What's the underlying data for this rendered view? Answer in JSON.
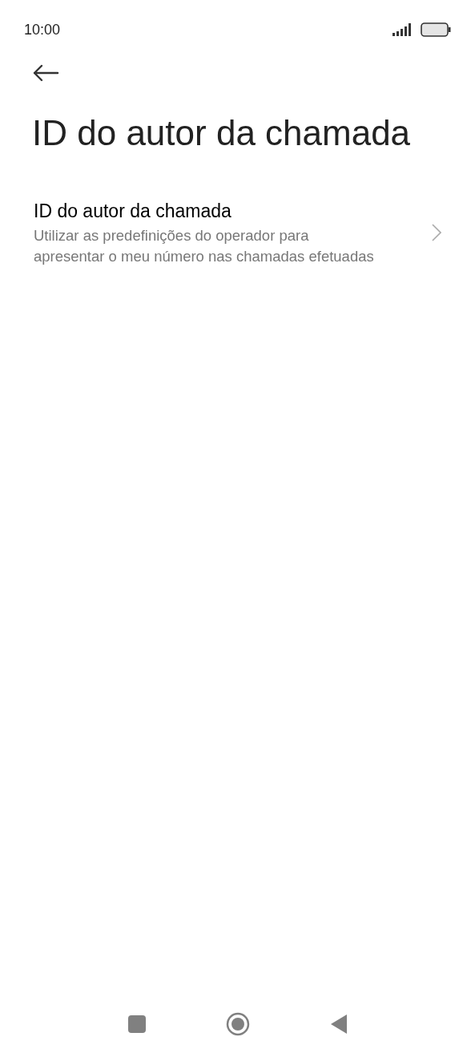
{
  "status_bar": {
    "time": "10:00"
  },
  "header": {
    "title": "ID do autor da chamada"
  },
  "items": [
    {
      "title": "ID do autor da chamada",
      "summary": "Utilizar as predefinições do operador para apresentar o meu número nas chamadas efetuadas"
    }
  ]
}
